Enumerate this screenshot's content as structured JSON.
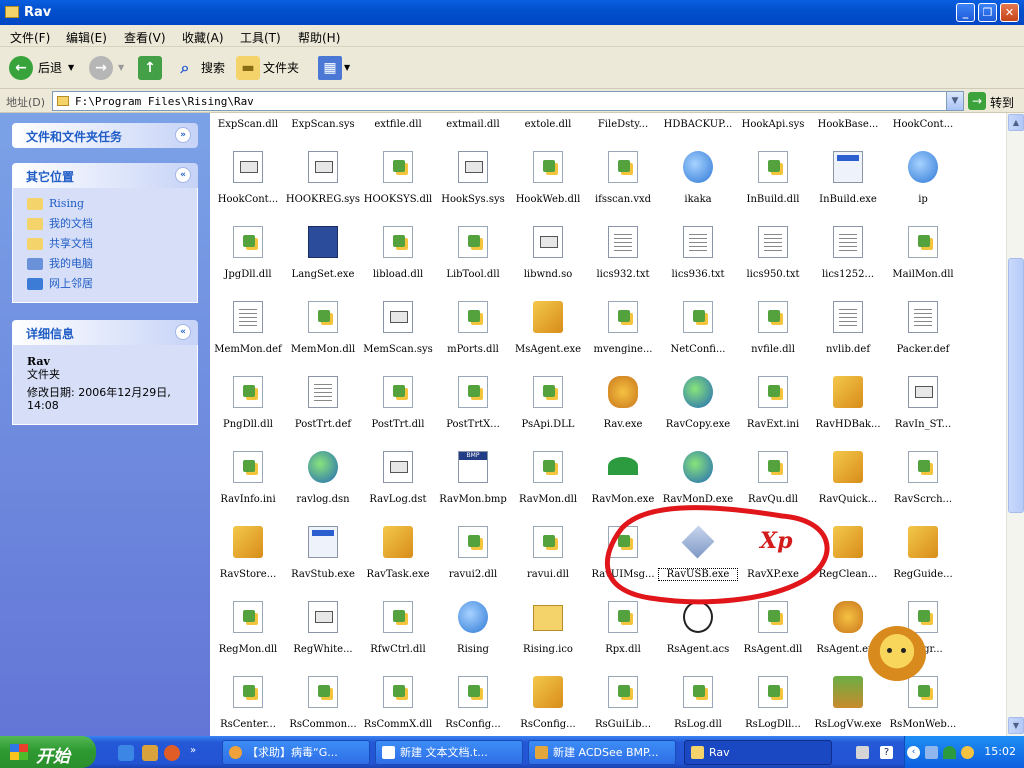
{
  "window": {
    "title": "Rav"
  },
  "menu": [
    "文件(F)",
    "编辑(E)",
    "查看(V)",
    "收藏(A)",
    "工具(T)",
    "帮助(H)"
  ],
  "toolbar": {
    "back": "后退",
    "search": "搜索",
    "folders": "文件夹"
  },
  "address": {
    "label": "地址(D)",
    "value": "F:\\Program Files\\Rising\\Rav",
    "go": "转到"
  },
  "leftpanel": {
    "tasks_title": "文件和文件夹任务",
    "places_title": "其它位置",
    "places": [
      "Rising",
      "我的文档",
      "共享文档",
      "我的电脑",
      "网上邻居"
    ],
    "details_title": "详细信息",
    "details_name": "Rav",
    "details_type": "文件夹",
    "details_date": "修改日期: 2006年12月29日, 14:08"
  },
  "files": [
    {
      "name": "ExpScan.dll",
      "icon": "dll-icon"
    },
    {
      "name": "ExpScan.sys",
      "icon": "sys-icon"
    },
    {
      "name": "extfile.dll",
      "icon": "dll-icon"
    },
    {
      "name": "extmail.dll",
      "icon": "dll-icon"
    },
    {
      "name": "extole.dll",
      "icon": "dll-icon"
    },
    {
      "name": "FileDsty...",
      "icon": "dll-icon"
    },
    {
      "name": "HDBACKUP...",
      "icon": "dll-icon"
    },
    {
      "name": "HookApi.sys",
      "icon": "sys-icon"
    },
    {
      "name": "HookBase...",
      "icon": "dll-icon"
    },
    {
      "name": "HookCont...",
      "icon": "dll-icon"
    },
    {
      "name": "HookCont...",
      "icon": "sys-icon"
    },
    {
      "name": "HOOKREG.sys",
      "icon": "sys-icon"
    },
    {
      "name": "HOOKSYS.dll",
      "icon": "dll-icon"
    },
    {
      "name": "HookSys.sys",
      "icon": "sys-icon"
    },
    {
      "name": "HookWeb.dll",
      "icon": "dll-icon"
    },
    {
      "name": "ifsscan.vxd",
      "icon": "dll-icon"
    },
    {
      "name": "ikaka",
      "icon": "web-shortcut-icon"
    },
    {
      "name": "InBuild.dll",
      "icon": "dll-icon"
    },
    {
      "name": "InBuild.exe",
      "icon": "exe-icon"
    },
    {
      "name": "ip",
      "icon": "web-shortcut-icon"
    },
    {
      "name": "JpgDll.dll",
      "icon": "dll-icon"
    },
    {
      "name": "LangSet.exe",
      "icon": "flag-icon"
    },
    {
      "name": "libload.dll",
      "icon": "dll-icon"
    },
    {
      "name": "LibTool.dll",
      "icon": "dll-icon"
    },
    {
      "name": "libwnd.so",
      "icon": "sys-icon"
    },
    {
      "name": "lics932.txt",
      "icon": "doc-icon"
    },
    {
      "name": "lics936.txt",
      "icon": "doc-icon"
    },
    {
      "name": "lics950.txt",
      "icon": "doc-icon"
    },
    {
      "name": "lics1252...",
      "icon": "doc-icon"
    },
    {
      "name": "MailMon.dll",
      "icon": "dll-icon"
    },
    {
      "name": "MemMon.def",
      "icon": "doc-icon"
    },
    {
      "name": "MemMon.dll",
      "icon": "dll-icon"
    },
    {
      "name": "MemScan.sys",
      "icon": "sys-icon"
    },
    {
      "name": "mPorts.dll",
      "icon": "dll-icon"
    },
    {
      "name": "MsAgent.exe",
      "icon": "misc-icon"
    },
    {
      "name": "mvengine...",
      "icon": "dll-icon"
    },
    {
      "name": "NetConfi...",
      "icon": "dll-icon"
    },
    {
      "name": "nvfile.dll",
      "icon": "dll-icon"
    },
    {
      "name": "nvlib.def",
      "icon": "doc-icon"
    },
    {
      "name": "Packer.def",
      "icon": "doc-icon"
    },
    {
      "name": "PngDll.dll",
      "icon": "dll-icon"
    },
    {
      "name": "PostTrt.def",
      "icon": "doc-icon"
    },
    {
      "name": "PostTrt.dll",
      "icon": "dll-icon"
    },
    {
      "name": "PostTrtX...",
      "icon": "dll-icon"
    },
    {
      "name": "PsApi.DLL",
      "icon": "dll-icon"
    },
    {
      "name": "Rav.exe",
      "icon": "lion-icon"
    },
    {
      "name": "RavCopy.exe",
      "icon": "globe-icon"
    },
    {
      "name": "RavExt.ini",
      "icon": "dll-icon"
    },
    {
      "name": "RavHDBak...",
      "icon": "misc-icon"
    },
    {
      "name": "RavIn_ST...",
      "icon": "sys-icon"
    },
    {
      "name": "RavInfo.ini",
      "icon": "dll-icon"
    },
    {
      "name": "ravlog.dsn",
      "icon": "globe-icon"
    },
    {
      "name": "RavLog.dst",
      "icon": "sys-icon"
    },
    {
      "name": "RavMon.bmp",
      "icon": "bmp-icon"
    },
    {
      "name": "RavMon.dll",
      "icon": "dll-icon"
    },
    {
      "name": "RavMon.exe",
      "icon": "umbrella-icon"
    },
    {
      "name": "RavMonD.exe",
      "icon": "globe-icon"
    },
    {
      "name": "RavQu.dll",
      "icon": "dll-icon"
    },
    {
      "name": "RavQuick...",
      "icon": "misc-icon"
    },
    {
      "name": "RavScrch...",
      "icon": "dll-icon"
    },
    {
      "name": "RavStore...",
      "icon": "misc-icon"
    },
    {
      "name": "RavStub.exe",
      "icon": "exe-icon"
    },
    {
      "name": "RavTask.exe",
      "icon": "misc-icon"
    },
    {
      "name": "ravui2.dll",
      "icon": "dll-icon"
    },
    {
      "name": "ravui.dll",
      "icon": "dll-icon"
    },
    {
      "name": "RavUIMsg...",
      "icon": "dll-icon"
    },
    {
      "name": "RavUSB.exe",
      "icon": "usb-icon"
    },
    {
      "name": "RavXP.exe",
      "icon": "xp-icon"
    },
    {
      "name": "RegClean...",
      "icon": "misc-icon"
    },
    {
      "name": "RegGuide...",
      "icon": "misc-icon"
    },
    {
      "name": "RegMon.dll",
      "icon": "dll-icon"
    },
    {
      "name": "RegWhite...",
      "icon": "sys-icon"
    },
    {
      "name": "RfwCtrl.dll",
      "icon": "dll-icon"
    },
    {
      "name": "Rising",
      "icon": "web-shortcut-icon"
    },
    {
      "name": "Rising.ico",
      "icon": "folder-icon"
    },
    {
      "name": "Rpx.dll",
      "icon": "dll-icon"
    },
    {
      "name": "RsAgent.acs",
      "icon": "acs-icon"
    },
    {
      "name": "RsAgent.dll",
      "icon": "dll-icon"
    },
    {
      "name": "RsAgent.exe",
      "icon": "lion-icon"
    },
    {
      "name": "RsAgr...",
      "icon": "dll-icon"
    },
    {
      "name": "RsCenter...",
      "icon": "dll-icon"
    },
    {
      "name": "RsCommon...",
      "icon": "dll-icon"
    },
    {
      "name": "RsCommX.dll",
      "icon": "dll-icon"
    },
    {
      "name": "RsConfig...",
      "icon": "dll-icon"
    },
    {
      "name": "RsConfig...",
      "icon": "misc-icon"
    },
    {
      "name": "RsGuiLib...",
      "icon": "dll-icon"
    },
    {
      "name": "RsLog.dll",
      "icon": "dll-icon"
    },
    {
      "name": "RsLogDll...",
      "icon": "dll-icon"
    },
    {
      "name": "RsLogVw.exe",
      "icon": "book-icon"
    },
    {
      "name": "RsMonWeb...",
      "icon": "dll-icon"
    }
  ],
  "taskbar": {
    "start": "开始",
    "tasks": [
      {
        "label": "【求助】病毒“G..."
      },
      {
        "label": "新建 文本文档.t..."
      },
      {
        "label": "新建 ACDSee BMP..."
      },
      {
        "label": "Rav"
      }
    ],
    "clock": "15:02"
  },
  "colors": {
    "annotation": "#e0161b",
    "titlebar": "#0250cd",
    "panel": "#6b8de0"
  }
}
